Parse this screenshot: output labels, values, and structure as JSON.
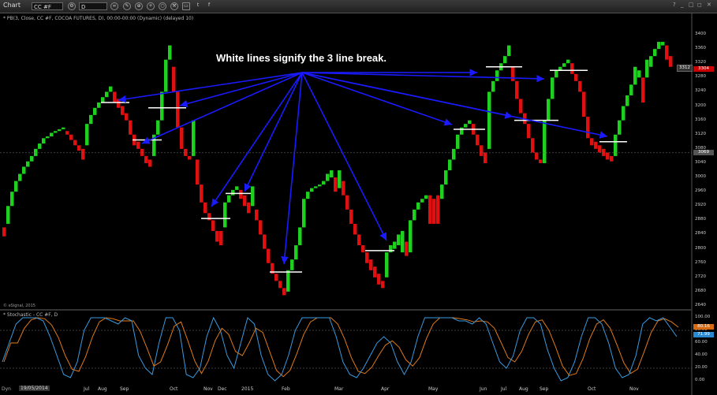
{
  "window": {
    "title": "Chart",
    "symbol": "CC #F",
    "interval": "D"
  },
  "chart": {
    "subtitle": "* PB(3, Close, CC #F, COCOA FUTURES, D), 00:00-00:00 (Dynamic) (delayed 10)",
    "source": "© eSignal, 2015",
    "annotation": "White lines signify the 3 line break.",
    "price_tag": "3304",
    "price_tag2": "3312",
    "level_label": "3069",
    "y_labels": [
      "3400",
      "3360",
      "3320",
      "3280",
      "3240",
      "3200",
      "3160",
      "3120",
      "3080",
      "3040",
      "3000",
      "2960",
      "2920",
      "2880",
      "2840",
      "2800",
      "2760",
      "2720",
      "2680",
      "2640"
    ],
    "x_labels": [
      "Jul",
      "Aug",
      "Sep",
      "Oct",
      "Nov",
      "Dec",
      "2015",
      "Feb",
      "Mar",
      "Apr",
      "May",
      "Jun",
      "Jul",
      "Aug",
      "Sep",
      "Oct",
      "Nov"
    ],
    "date_box": "19/05/2014",
    "dyn_label": "Dyn"
  },
  "stoch": {
    "label": "* Stochastic - CC #F, D",
    "y_labels": [
      "100.00",
      "80.00",
      "60.00",
      "40.00",
      "20.00",
      "0.00"
    ],
    "tag1": "80.16",
    "tag2": "71.99"
  },
  "colors": {
    "up": "#1fd11f",
    "down": "#e01010",
    "arrow": "#1a1aff",
    "k": "#3a9be0",
    "d": "#e07a1a"
  },
  "chart_data": {
    "type": "line",
    "title": "",
    "description_series": [
      {
        "name": "PB(3, Close, CC #F)",
        "x": [
          "Jul",
          "Aug",
          "Sep",
          "Oct",
          "Nov",
          "Dec",
          "2015",
          "Feb",
          "Mar",
          "Apr",
          "May",
          "Jun",
          "Jul",
          "Aug",
          "Sep",
          "Oct",
          "Nov"
        ],
        "values": [
          3100,
          3220,
          3200,
          3370,
          2900,
          2970,
          2950,
          2690,
          3020,
          2720,
          2940,
          3370,
          3310,
          3060,
          3310,
          3060,
          3380
        ]
      }
    ],
    "ylim": [
      2620,
      3420
    ]
  }
}
